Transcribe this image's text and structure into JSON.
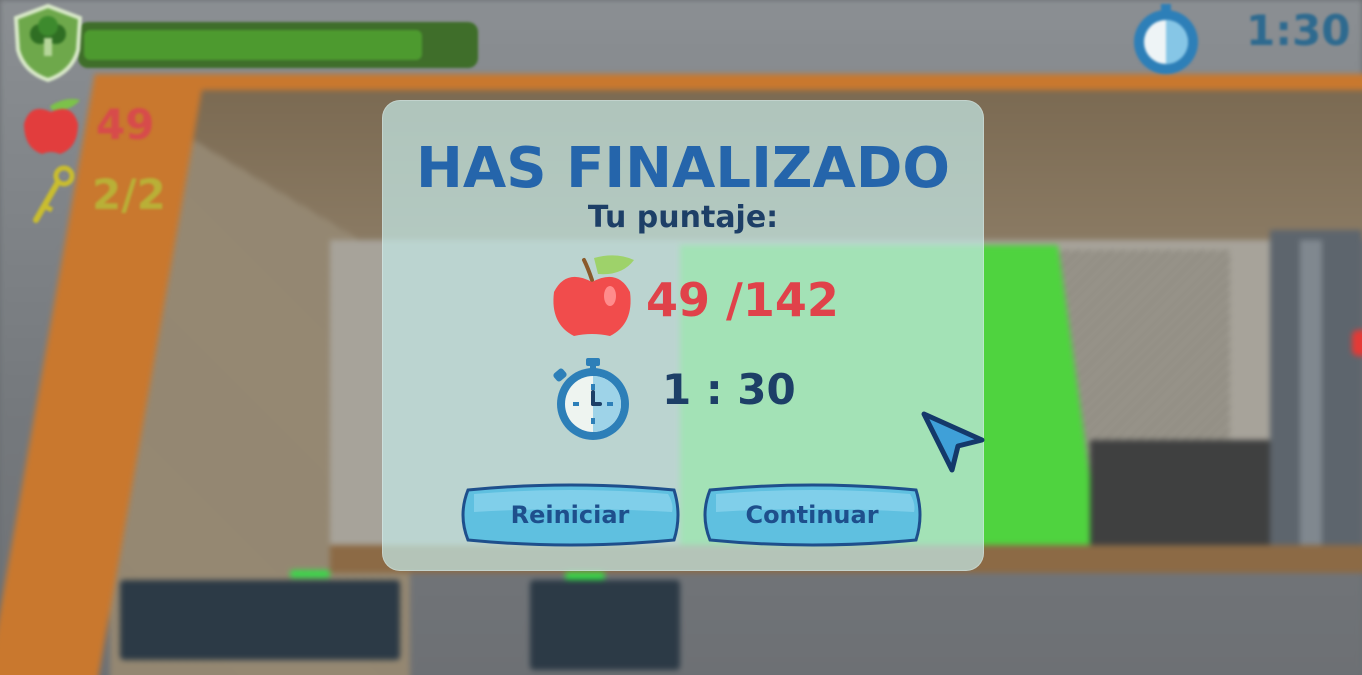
{
  "hud": {
    "apple_count": "49",
    "key_count": "2/2",
    "timer": "1:30",
    "health_fraction": 0.87,
    "icons": [
      "broccoli-shield-icon",
      "apple-icon",
      "key-icon",
      "stopwatch-icon"
    ]
  },
  "modal": {
    "title": "HAS FINALIZADO",
    "subtitle": "Tu puntaje:",
    "score": "49 /142",
    "time": "1 : 30",
    "restart_label": "Reiniciar",
    "continue_label": "Continuar"
  },
  "colors": {
    "title": "#2565ab",
    "score": "#e0424a",
    "button": "#5fc0e0",
    "button_text": "#1e4f8c",
    "panel": "#c4e8e4",
    "wall": "#c9782e",
    "goal_floor": "#4fd33f"
  }
}
